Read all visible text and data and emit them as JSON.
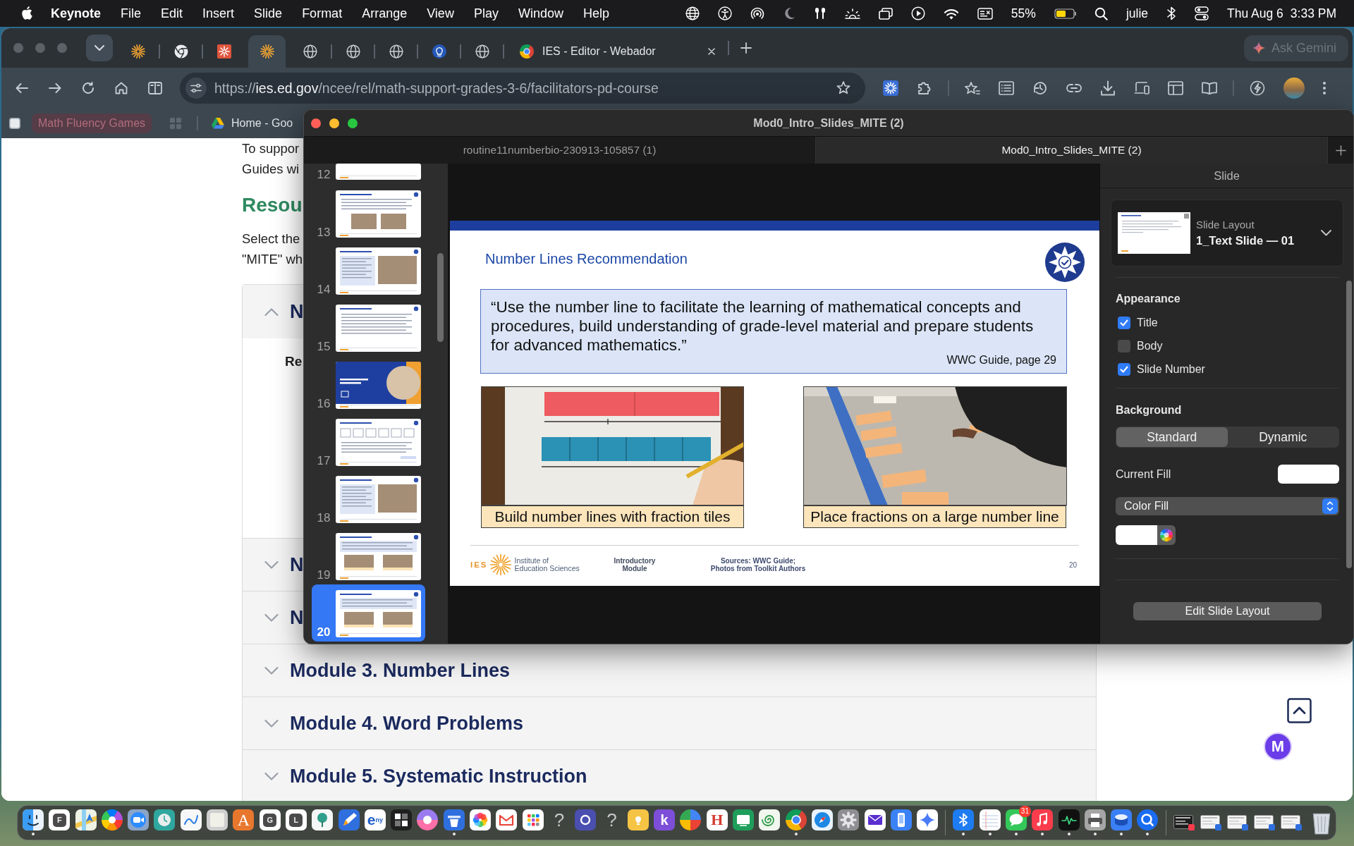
{
  "menu_bar": {
    "app_name": "Keynote",
    "menus": [
      "File",
      "Edit",
      "Insert",
      "Slide",
      "Format",
      "Arrange",
      "View",
      "Play",
      "Window",
      "Help"
    ],
    "battery_reading": "55%",
    "user": "julie",
    "date": "Thu Aug 6",
    "time": "3:33 PM"
  },
  "browser": {
    "tabs": [
      {
        "selected": false
      },
      {
        "selected": false
      },
      {
        "selected": false
      },
      {
        "selected": true
      },
      {
        "selected": false
      },
      {
        "selected": false
      },
      {
        "selected": false
      },
      {
        "selected": false
      },
      {
        "selected": false
      },
      {
        "title": "IES - Editor - Webador",
        "selected": false
      }
    ],
    "ask_button": "Ask Gemini",
    "address": {
      "scheme": "https://",
      "host": "ies.ed.gov",
      "path": "/ncee/rel/math-support-grades-3-6/facilitators-pd-course"
    },
    "bookmarks": [
      {
        "kind": "chip",
        "label": "Math Fluency Games"
      },
      {
        "kind": "link",
        "label": "Home - Goo"
      }
    ],
    "page": {
      "intro_lines": [
        "To suppor",
        "Guides wi"
      ],
      "heading": "Resou",
      "body_lines": [
        "Select the",
        "\"MITE\" wh"
      ],
      "accordion": [
        {
          "title": "N",
          "expanded": true,
          "content": "Re"
        },
        {
          "title": "N",
          "expanded": false
        },
        {
          "title": "N",
          "expanded": false
        },
        {
          "title": "Module 3. Number Lines",
          "expanded": false
        },
        {
          "title": "Module 4. Word Problems",
          "expanded": false
        },
        {
          "title": "Module 5. Systematic Instruction",
          "expanded": false
        }
      ],
      "assistant_badge": "M"
    }
  },
  "keynote": {
    "window_title": "Mod0_Intro_Slides_MITE (2)",
    "document_tabs": [
      {
        "title": "routine11numberbio-230913-105857 (1)",
        "selected": false
      },
      {
        "title": "Mod0_Intro_Slides_MITE (2)",
        "selected": true
      }
    ],
    "slides": [
      {
        "number": "12",
        "selected": false
      },
      {
        "number": "13",
        "selected": false
      },
      {
        "number": "14",
        "selected": false
      },
      {
        "number": "15",
        "selected": false
      },
      {
        "number": "16",
        "selected": false
      },
      {
        "number": "17",
        "selected": false
      },
      {
        "number": "18",
        "selected": false
      },
      {
        "number": "19",
        "selected": false
      },
      {
        "number": "20",
        "selected": true
      }
    ],
    "slide": {
      "title": "Number Lines Recommendation",
      "quote_lines": [
        "“Use the number line to facilitate the learning of mathematical concepts and",
        "procedures, build understanding of grade-level material and prepare students",
        "for advanced mathematics.”"
      ],
      "quote_source": "WWC Guide, page 29",
      "photos": [
        {
          "caption": "Build number lines with fraction tiles"
        },
        {
          "caption": "Place fractions on a large number line"
        }
      ],
      "footer": {
        "logo_letters": "IES",
        "organization_lines": [
          "Institute of",
          "Education Sciences"
        ],
        "module_lines": [
          "Introductory",
          "Module"
        ],
        "sources_lines": [
          "Sources: WWC Guide;",
          "Photos from Toolkit Authors"
        ],
        "page_number": "20"
      }
    },
    "inspector": {
      "header": "Slide",
      "layout_label": "Slide Layout",
      "layout_name": "1_Text Slide — 01",
      "appearance_heading": "Appearance",
      "appearance": [
        {
          "label": "Title",
          "checked": true
        },
        {
          "label": "Body",
          "checked": false
        },
        {
          "label": "Slide Number",
          "checked": true
        }
      ],
      "background_heading": "Background",
      "background_modes": [
        {
          "label": "Standard",
          "selected": true
        },
        {
          "label": "Dynamic",
          "selected": false
        }
      ],
      "current_fill_label": "Current Fill",
      "fill_type": "Color Fill",
      "edit_button": "Edit Slide Layout"
    }
  },
  "dock": {
    "apps": [
      {
        "running": true
      },
      {
        "label": "F",
        "running": false
      },
      {
        "running": false
      },
      {
        "running": false
      },
      {
        "running": false
      },
      {
        "running": false
      },
      {
        "running": false
      },
      {
        "running": false
      },
      {
        "label": "A",
        "running": false
      },
      {
        "label": "G",
        "running": false
      },
      {
        "label": "L",
        "running": false
      },
      {
        "running": false
      },
      {
        "running": false
      },
      {
        "label": "e$^{ny}$",
        "running": false
      },
      {
        "running": false
      },
      {
        "running": false
      },
      {
        "running": true
      },
      {
        "running": false
      },
      {
        "running": false
      },
      {
        "running": false
      },
      {
        "label": "?",
        "running": false
      },
      {
        "running": false
      },
      {
        "label": "?",
        "running": false
      },
      {
        "running": false
      },
      {
        "label": "k",
        "running": false
      },
      {
        "running": false
      },
      {
        "label": "H",
        "running": false
      },
      {
        "running": false
      },
      {
        "running": false
      },
      {
        "running": true
      },
      {
        "running": false
      },
      {
        "running": false
      },
      {
        "running": false
      },
      {
        "running": false
      },
      {
        "running": false
      },
      {
        "running": true
      },
      {
        "running": true
      },
      {
        "badge": "31",
        "running": true
      },
      {
        "running": true
      },
      {
        "running": true
      },
      {
        "running": true
      },
      {
        "running": true
      },
      {
        "running": true
      }
    ]
  }
}
